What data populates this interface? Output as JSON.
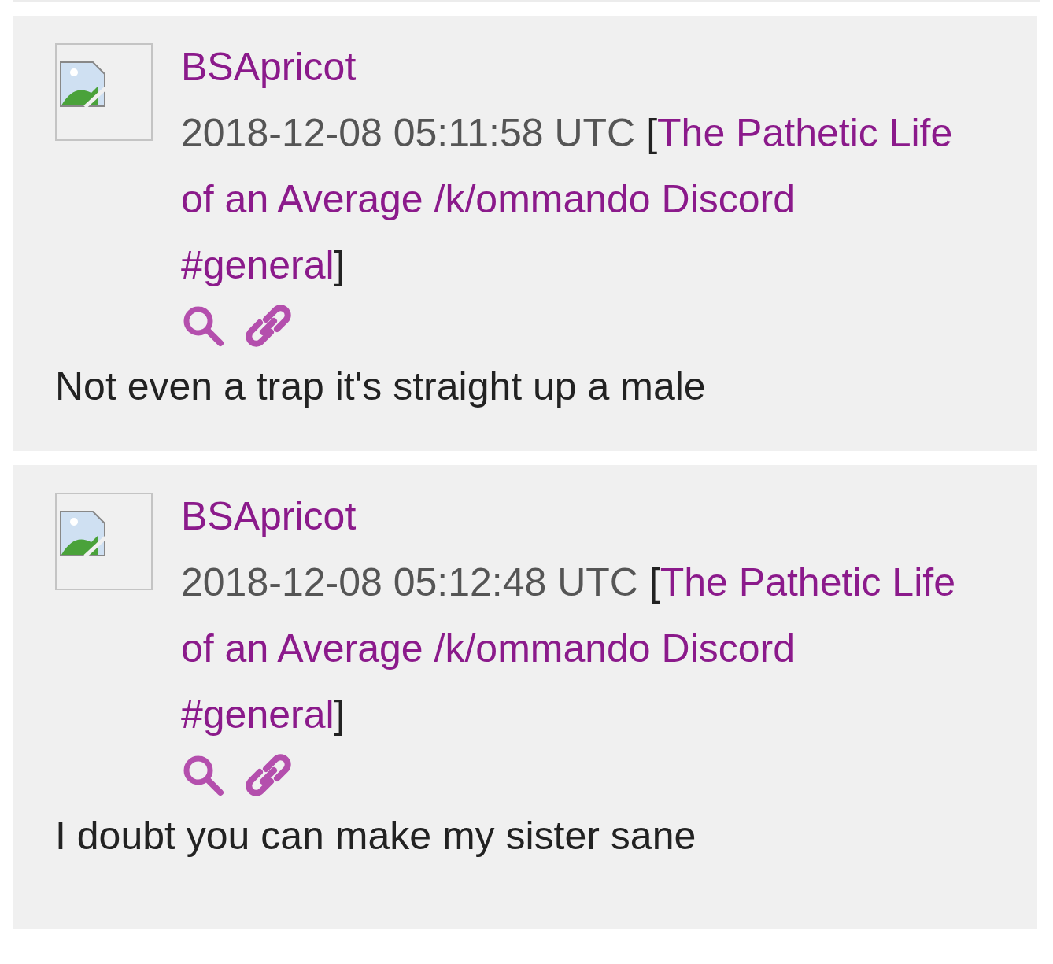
{
  "posts": [
    {
      "author": "BSApricot",
      "timestamp": "2018-12-08 05:11:58 UTC",
      "open_bracket": "[",
      "channel": "The Pathetic Life of an Average /k/ommando Discord #general",
      "close_bracket": "]",
      "body": "Not even a trap it's straight up a male"
    },
    {
      "author": "BSApricot",
      "timestamp": "2018-12-08 05:12:48 UTC",
      "open_bracket": "[",
      "channel": "The Pathetic Life of an Average /k/ommando Discord #general",
      "close_bracket": "]",
      "body": "I doubt you can make my sister sane"
    }
  ]
}
